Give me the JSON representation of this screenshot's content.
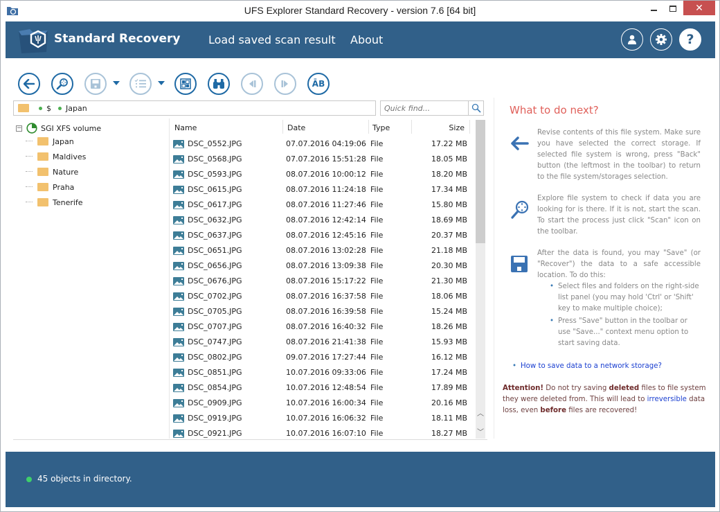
{
  "window": {
    "title": "UFS Explorer Standard Recovery - version 7.6 [64 bit]",
    "controls": {
      "minimize": "–",
      "maximize": "☐",
      "close": "✕"
    }
  },
  "header": {
    "brand": "Standard Recovery",
    "nav": [
      {
        "label": "Load saved scan result"
      },
      {
        "label": "About"
      }
    ],
    "buttons": [
      {
        "name": "user-icon"
      },
      {
        "name": "gear-icon"
      },
      {
        "name": "help-icon",
        "label": "?"
      }
    ],
    "color": "#316089"
  },
  "toolbar": {
    "buttons": [
      {
        "name": "back",
        "icon": "arrow-left-icon",
        "enabled": true
      },
      {
        "name": "scan",
        "icon": "magnifier-icon",
        "enabled": true
      },
      {
        "name": "save",
        "icon": "floppy-icon",
        "enabled": false,
        "dropdown": true
      },
      {
        "name": "selection",
        "icon": "checklist-icon",
        "enabled": false,
        "dropdown": true
      },
      {
        "name": "view",
        "icon": "grid-icon",
        "enabled": true
      },
      {
        "name": "find",
        "icon": "binoculars-icon",
        "enabled": true
      },
      {
        "name": "previous",
        "icon": "prev-icon",
        "enabled": false
      },
      {
        "name": "next",
        "icon": "next-icon",
        "enabled": false
      },
      {
        "name": "encoding",
        "icon": "text-encoding-icon",
        "label": "ĀB",
        "enabled": true
      }
    ]
  },
  "path": {
    "segments": [
      "$",
      "Japan"
    ]
  },
  "quick_find": {
    "placeholder": "Quick find...",
    "value": ""
  },
  "tree": {
    "root": "SGI XFS volume",
    "items": [
      {
        "label": "Japan",
        "selected": true
      },
      {
        "label": "Maldives",
        "selected": false
      },
      {
        "label": "Nature",
        "selected": false
      },
      {
        "label": "Praha",
        "selected": false
      },
      {
        "label": "Tenerife",
        "selected": false
      }
    ]
  },
  "file_list": {
    "columns": [
      "Name",
      "Date",
      "Type",
      "Size"
    ],
    "rows": [
      {
        "name": "DSC_0552.JPG",
        "date": "07.07.2016 04:19:06",
        "type": "File",
        "size": "17.22 MB"
      },
      {
        "name": "DSC_0568.JPG",
        "date": "07.07.2016 15:51:28",
        "type": "File",
        "size": "18.05 MB"
      },
      {
        "name": "DSC_0593.JPG",
        "date": "08.07.2016 10:00:12",
        "type": "File",
        "size": "18.20 MB"
      },
      {
        "name": "DSC_0615.JPG",
        "date": "08.07.2016 11:24:18",
        "type": "File",
        "size": "17.34 MB"
      },
      {
        "name": "DSC_0617.JPG",
        "date": "08.07.2016 11:27:46",
        "type": "File",
        "size": "15.80 MB"
      },
      {
        "name": "DSC_0632.JPG",
        "date": "08.07.2016 12:42:14",
        "type": "File",
        "size": "18.69 MB"
      },
      {
        "name": "DSC_0637.JPG",
        "date": "08.07.2016 12:45:16",
        "type": "File",
        "size": "20.37 MB"
      },
      {
        "name": "DSC_0651.JPG",
        "date": "08.07.2016 13:02:28",
        "type": "File",
        "size": "21.18 MB"
      },
      {
        "name": "DSC_0656.JPG",
        "date": "08.07.2016 13:09:38",
        "type": "File",
        "size": "20.30 MB"
      },
      {
        "name": "DSC_0676.JPG",
        "date": "08.07.2016 15:17:22",
        "type": "File",
        "size": "21.30 MB"
      },
      {
        "name": "DSC_0702.JPG",
        "date": "08.07.2016 16:37:58",
        "type": "File",
        "size": "18.06 MB"
      },
      {
        "name": "DSC_0705.JPG",
        "date": "08.07.2016 16:39:58",
        "type": "File",
        "size": "15.24 MB"
      },
      {
        "name": "DSC_0707.JPG",
        "date": "08.07.2016 16:40:32",
        "type": "File",
        "size": "18.26 MB"
      },
      {
        "name": "DSC_0747.JPG",
        "date": "08.07.2016 21:41:38",
        "type": "File",
        "size": "15.93 MB"
      },
      {
        "name": "DSC_0802.JPG",
        "date": "09.07.2016 17:27:44",
        "type": "File",
        "size": "16.12 MB"
      },
      {
        "name": "DSC_0851.JPG",
        "date": "10.07.2016 09:33:06",
        "type": "File",
        "size": "17.24 MB"
      },
      {
        "name": "DSC_0854.JPG",
        "date": "10.07.2016 12:48:54",
        "type": "File",
        "size": "17.89 MB"
      },
      {
        "name": "DSC_0909.JPG",
        "date": "10.07.2016 16:00:34",
        "type": "File",
        "size": "20.16 MB"
      },
      {
        "name": "DSC_0919.JPG",
        "date": "10.07.2016 16:06:32",
        "type": "File",
        "size": "18.11 MB"
      },
      {
        "name": "DSC_0921.JPG",
        "date": "10.07.2016 16:07:10",
        "type": "File",
        "size": "18.27 MB"
      }
    ]
  },
  "help": {
    "title": "What to do next?",
    "steps": [
      {
        "icon": "arrow-left-icon",
        "text": "Revise contents of this file system. Make sure you have selected the correct storage. If selected file system is wrong, press \"Back\" button (the leftmost in the toolbar) to return to the file system/storages selection."
      },
      {
        "icon": "magnifier-icon",
        "text": "Explore file system to check if data you are looking for is there. If it is not, start the scan. To start the process just click \"Scan\" icon on the toolbar."
      },
      {
        "icon": "floppy-icon",
        "text": "After the data is found, you may \"Save\" (or \"Recover\") the data to a safe accessible location. To do this:",
        "bullets": [
          "Select files and folders on the right-side list panel (you may hold 'Ctrl' or 'Shift' key to make multiple choice);",
          "Press \"Save\" button in the toolbar or use \"Save...\" context menu option to start saving data."
        ]
      }
    ],
    "link": "How to save data to a network storage?",
    "attention": {
      "label": "Attention!",
      "t1": " Do not try saving ",
      "b1": "deleted",
      "t2": " files to file system they were deleted from. This will lead to ",
      "link": "irreversible",
      "t3": " data loss, even ",
      "b2": "before",
      "t4": " files are recovered!"
    }
  },
  "status": {
    "text": "45 objects in directory.",
    "indicator_color": "#3fcf6a"
  }
}
